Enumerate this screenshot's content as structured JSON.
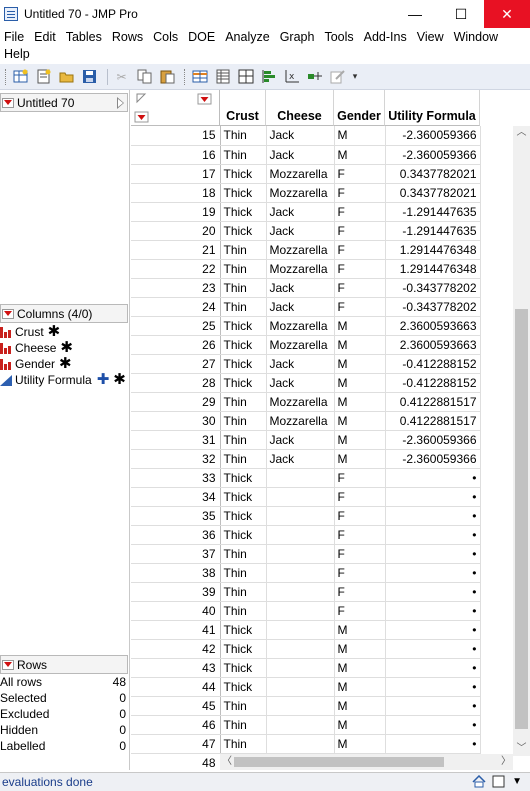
{
  "window": {
    "title": "Untitled 70 - JMP Pro",
    "min_glyph": "—",
    "max_glyph": "☐",
    "close_glyph": "✕"
  },
  "menu": {
    "items": [
      "File",
      "Edit",
      "Tables",
      "Rows",
      "Cols",
      "DOE",
      "Analyze",
      "Graph",
      "Tools",
      "Add-Ins",
      "View",
      "Window"
    ],
    "help": "Help"
  },
  "toolbar": {
    "icons": [
      "new-table-icon",
      "new-script-icon",
      "open-icon",
      "save-icon",
      "cut-icon",
      "copy-icon",
      "paste-icon",
      "data-table-icon",
      "column-icon",
      "grid-icon",
      "distribution-icon",
      "fit-y-by-x-icon",
      "fit-model-icon",
      "edit-script-icon"
    ]
  },
  "table_panel": {
    "name": "Untitled 70"
  },
  "columns_panel": {
    "header": "Columns (4/0)",
    "columns": [
      {
        "name": "Crust",
        "type": "nominal"
      },
      {
        "name": "Cheese",
        "type": "nominal"
      },
      {
        "name": "Gender",
        "type": "nominal"
      },
      {
        "name": "Utility Formula",
        "type": "continuous"
      }
    ]
  },
  "rows_panel": {
    "header": "Rows",
    "stats": [
      {
        "label": "All rows",
        "value": "48"
      },
      {
        "label": "Selected",
        "value": "0"
      },
      {
        "label": "Excluded",
        "value": "0"
      },
      {
        "label": "Hidden",
        "value": "0"
      },
      {
        "label": "Labelled",
        "value": "0"
      }
    ]
  },
  "grid": {
    "headers": [
      "Crust",
      "Cheese",
      "Gender",
      "Utility Formula"
    ],
    "rows": [
      [
        "15",
        "Thin",
        "Jack",
        "M",
        "-2.360059366"
      ],
      [
        "16",
        "Thin",
        "Jack",
        "M",
        "-2.360059366"
      ],
      [
        "17",
        "Thick",
        "Mozzarella",
        "F",
        "0.3437782021"
      ],
      [
        "18",
        "Thick",
        "Mozzarella",
        "F",
        "0.3437782021"
      ],
      [
        "19",
        "Thick",
        "Jack",
        "F",
        "-1.291447635"
      ],
      [
        "20",
        "Thick",
        "Jack",
        "F",
        "-1.291447635"
      ],
      [
        "21",
        "Thin",
        "Mozzarella",
        "F",
        "1.2914476348"
      ],
      [
        "22",
        "Thin",
        "Mozzarella",
        "F",
        "1.2914476348"
      ],
      [
        "23",
        "Thin",
        "Jack",
        "F",
        "-0.343778202"
      ],
      [
        "24",
        "Thin",
        "Jack",
        "F",
        "-0.343778202"
      ],
      [
        "25",
        "Thick",
        "Mozzarella",
        "M",
        "2.3600593663"
      ],
      [
        "26",
        "Thick",
        "Mozzarella",
        "M",
        "2.3600593663"
      ],
      [
        "27",
        "Thick",
        "Jack",
        "M",
        "-0.412288152"
      ],
      [
        "28",
        "Thick",
        "Jack",
        "M",
        "-0.412288152"
      ],
      [
        "29",
        "Thin",
        "Mozzarella",
        "M",
        "0.4122881517"
      ],
      [
        "30",
        "Thin",
        "Mozzarella",
        "M",
        "0.4122881517"
      ],
      [
        "31",
        "Thin",
        "Jack",
        "M",
        "-2.360059366"
      ],
      [
        "32",
        "Thin",
        "Jack",
        "M",
        "-2.360059366"
      ],
      [
        "33",
        "Thick",
        "",
        "F",
        "•"
      ],
      [
        "34",
        "Thick",
        "",
        "F",
        "•"
      ],
      [
        "35",
        "Thick",
        "",
        "F",
        "•"
      ],
      [
        "36",
        "Thick",
        "",
        "F",
        "•"
      ],
      [
        "37",
        "Thin",
        "",
        "F",
        "•"
      ],
      [
        "38",
        "Thin",
        "",
        "F",
        "•"
      ],
      [
        "39",
        "Thin",
        "",
        "F",
        "•"
      ],
      [
        "40",
        "Thin",
        "",
        "F",
        "•"
      ],
      [
        "41",
        "Thick",
        "",
        "M",
        "•"
      ],
      [
        "42",
        "Thick",
        "",
        "M",
        "•"
      ],
      [
        "43",
        "Thick",
        "",
        "M",
        "•"
      ],
      [
        "44",
        "Thick",
        "",
        "M",
        "•"
      ],
      [
        "45",
        "Thin",
        "",
        "M",
        "•"
      ],
      [
        "46",
        "Thin",
        "",
        "M",
        "•"
      ],
      [
        "47",
        "Thin",
        "",
        "M",
        "•"
      ],
      [
        "48",
        "",
        "",
        "",
        ""
      ]
    ]
  },
  "status": {
    "text": "evaluations done"
  },
  "colors": {
    "close_button": "#e81123",
    "red_triangle": "#d01010",
    "nominal_icon": "#c8201c",
    "continuous_icon": "#2c5fb0"
  }
}
